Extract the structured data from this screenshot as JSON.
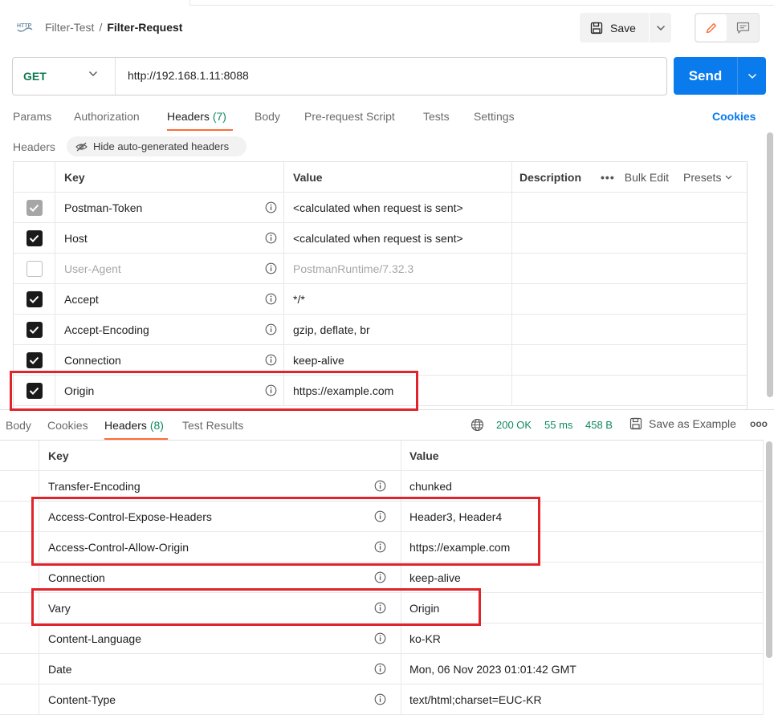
{
  "header": {
    "collection": "Filter-Test",
    "separator": "/",
    "request_name": "Filter-Request",
    "save_label": "Save"
  },
  "request": {
    "method": "GET",
    "url": "http://192.168.1.11:8088",
    "send_label": "Send"
  },
  "request_tabs": [
    {
      "label": "Params"
    },
    {
      "label": "Authorization"
    },
    {
      "label": "Headers",
      "count": "(7)"
    },
    {
      "label": "Body"
    },
    {
      "label": "Pre-request Script"
    },
    {
      "label": "Tests"
    },
    {
      "label": "Settings"
    }
  ],
  "cookies_link": "Cookies",
  "headers_section": {
    "label": "Headers",
    "hide_chip": "Hide auto-generated headers"
  },
  "request_headers": {
    "columns": [
      "Key",
      "Value",
      "Description"
    ],
    "bulk_edit": "Bulk Edit",
    "presets": "Presets",
    "rows": [
      {
        "key": "Postman-Token",
        "value": "<calculated when request is sent>",
        "state": "auto"
      },
      {
        "key": "Host",
        "value": "<calculated when request is sent>",
        "state": "on"
      },
      {
        "key": "User-Agent",
        "value": "PostmanRuntime/7.32.3",
        "state": "off"
      },
      {
        "key": "Accept",
        "value": "*/*",
        "state": "on"
      },
      {
        "key": "Accept-Encoding",
        "value": "gzip, deflate, br",
        "state": "on"
      },
      {
        "key": "Connection",
        "value": "keep-alive",
        "state": "on"
      },
      {
        "key": "Origin",
        "value": "https://example.com",
        "state": "on"
      }
    ]
  },
  "response_tabs": [
    {
      "label": "Body"
    },
    {
      "label": "Cookies"
    },
    {
      "label": "Headers",
      "count": "(8)"
    },
    {
      "label": "Test Results"
    }
  ],
  "response_status": {
    "status": "200 OK",
    "time": "55 ms",
    "size": "458 B",
    "save_example": "Save as Example"
  },
  "response_headers": {
    "columns": [
      "Key",
      "Value"
    ],
    "rows": [
      {
        "key": "Transfer-Encoding",
        "value": "chunked"
      },
      {
        "key": "Access-Control-Expose-Headers",
        "value": "Header3, Header4"
      },
      {
        "key": "Access-Control-Allow-Origin",
        "value": "https://example.com"
      },
      {
        "key": "Connection",
        "value": "keep-alive"
      },
      {
        "key": "Vary",
        "value": "Origin"
      },
      {
        "key": "Content-Language",
        "value": "ko-KR"
      },
      {
        "key": "Date",
        "value": "Mon, 06 Nov 2023 01:01:42 GMT"
      },
      {
        "key": "Content-Type",
        "value": "text/html;charset=EUC-KR"
      }
    ]
  },
  "colors": {
    "accent": "#ff6c37",
    "send": "#097bed",
    "highlight": "#e0242c",
    "status_ok": "#0f8a5f"
  }
}
